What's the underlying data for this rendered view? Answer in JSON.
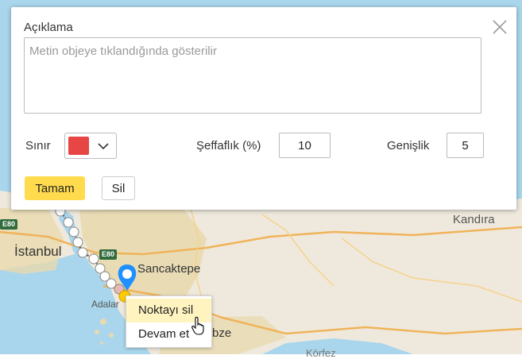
{
  "map": {
    "labels": {
      "istanbul": "İstanbul",
      "sancaktepe": "Sancaktepe",
      "kandira": "Kandıra",
      "adalar": "Adalar",
      "gebze": "Gebze",
      "korfez": "Körfez"
    },
    "shields": [
      "E80",
      "E80"
    ],
    "colors": {
      "land": "#efe9dd",
      "water": "#a9d6ec",
      "urban": "#e8d9ae",
      "route_point": "#ffffff",
      "active_point": "#ffcc00",
      "marker": "#1e90ff"
    }
  },
  "dialog": {
    "title": "Açıklama",
    "description": {
      "value": "",
      "placeholder": "Metin objeye tıklandığında gösterilir"
    },
    "border_label": "Sınır",
    "border_color": "#e84545",
    "opacity_label": "Şeffaflık (%)",
    "opacity_value": "10",
    "width_label": "Genişlik",
    "width_value": "5",
    "ok_label": "Tamam",
    "delete_label": "Sil",
    "close_icon": "close-icon",
    "dropdown_icon": "chevron-down-icon"
  },
  "context_menu": {
    "items": [
      "Noktayı sil",
      "Devam et"
    ]
  }
}
